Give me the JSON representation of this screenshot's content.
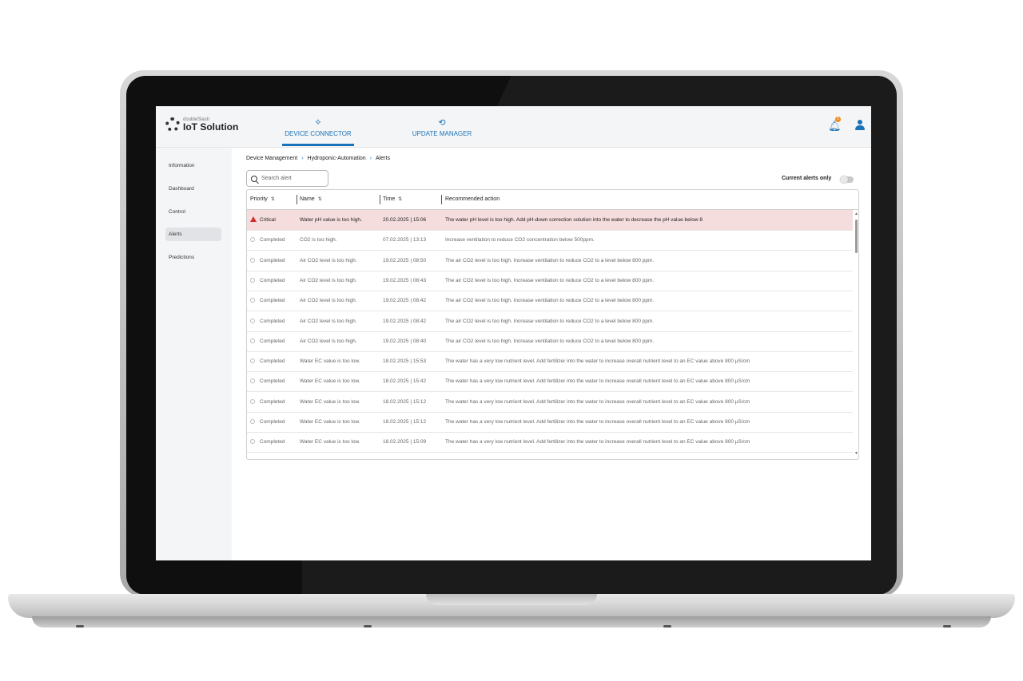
{
  "app": {
    "brand_small": "doubleSlash",
    "brand_main": "IoT Solution"
  },
  "nav": {
    "tabs": [
      {
        "label": "DEVICE CONNECTOR",
        "icon": "device-connector-icon",
        "active": true
      },
      {
        "label": "UPDATE MANAGER",
        "icon": "update-manager-icon",
        "active": false
      }
    ],
    "notification_count": "1"
  },
  "sidebar": {
    "items": [
      {
        "label": "Information"
      },
      {
        "label": "Dashboard"
      },
      {
        "label": "Control"
      },
      {
        "label": "Alerts",
        "active": true
      },
      {
        "label": "Predictions"
      }
    ]
  },
  "breadcrumb": [
    "Device Management",
    "Hydroponic-Automation",
    "Alerts"
  ],
  "search": {
    "placeholder": "Search alert"
  },
  "filter": {
    "label": "Current alerts only",
    "enabled": false
  },
  "table": {
    "headers": [
      "Priority",
      "Name",
      "Time",
      "Recommended action"
    ],
    "rows": [
      {
        "priority": "Critical",
        "name": "Water pH value is too high.",
        "time": "20.02.2025 | 15:06",
        "action": "The water pH level is too high. Add pH-down correction solution into the water to decrease the pH value below 8"
      },
      {
        "priority": "Completed",
        "name": "CO2 is too high.",
        "time": "07.02.2025 | 13:13",
        "action": "Increase ventilation to reduce CO2 concentration below 500ppm."
      },
      {
        "priority": "Completed",
        "name": "Air CO2 level is too high.",
        "time": "19.02.2025 | 08:50",
        "action": "The air CO2 level is too high. Increase ventilation to reduce CO2 to a level below 800 ppm."
      },
      {
        "priority": "Completed",
        "name": "Air CO2 level is too high.",
        "time": "19.02.2025 | 08:43",
        "action": "The air CO2 level is too high. Increase ventilation to reduce CO2 to a level below 800 ppm."
      },
      {
        "priority": "Completed",
        "name": "Air CO2 level is too high.",
        "time": "19.02.2025 | 08:42",
        "action": "The air CO2 level is too high. Increase ventilation to reduce CO2 to a level below 800 ppm."
      },
      {
        "priority": "Completed",
        "name": "Air CO2 level is too high.",
        "time": "19.02.2025 | 08:42",
        "action": "The air CO2 level is too high. Increase ventilation to reduce CO2 to a level below 800 ppm."
      },
      {
        "priority": "Completed",
        "name": "Air CO2 level is too high.",
        "time": "19.02.2025 | 08:40",
        "action": "The air CO2 level is too high. Increase ventilation to reduce CO2 to a level below 800 ppm."
      },
      {
        "priority": "Completed",
        "name": "Water EC value is too low.",
        "time": "18.02.2025 | 15:53",
        "action": "The water has a very low nutrient level. Add fertilizer into the water to increase overall nutrient level to an EC value above 800 µS/cm"
      },
      {
        "priority": "Completed",
        "name": "Water EC value is too low.",
        "time": "18.02.2025 | 15:42",
        "action": "The water has a very low nutrient level. Add fertilizer into the water to increase overall nutrient level to an EC value above 800 µS/cm"
      },
      {
        "priority": "Completed",
        "name": "Water EC value is too low.",
        "time": "18.02.2025 | 15:12",
        "action": "The water has a very low nutrient level. Add fertilizer into the water to increase overall nutrient level to an EC value above 800 µS/cm"
      },
      {
        "priority": "Completed",
        "name": "Water EC value is too low.",
        "time": "18.02.2025 | 15:12",
        "action": "The water has a very low nutrient level. Add fertilizer into the water to increase overall nutrient level to an EC value above 800 µS/cm"
      },
      {
        "priority": "Completed",
        "name": "Water EC value is too low.",
        "time": "18.02.2025 | 15:09",
        "action": "The water has a very low nutrient level. Add fertilizer into the water to increase overall nutrient level to an EC value above 800 µS/cm"
      }
    ]
  },
  "colors": {
    "accent": "#1a73b8",
    "critical_bg": "#f5dcdd",
    "critical_icon": "#cf2e2e",
    "badge": "#f08c1e"
  }
}
